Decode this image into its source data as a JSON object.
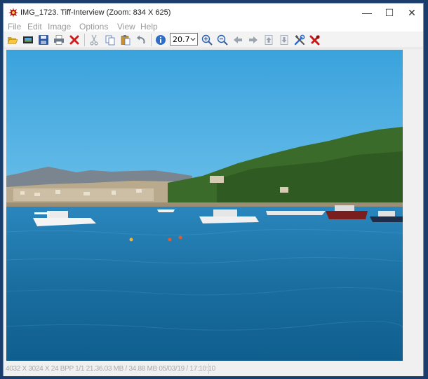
{
  "window": {
    "title": "IMG_1723. Tiff-Interview (Zoom: 834 X 625)",
    "controls": {
      "minimize": "—",
      "maximize": "☐",
      "close": "✕"
    }
  },
  "menu": [
    "File",
    "Edit",
    "Image",
    "Options",
    "View",
    "Help"
  ],
  "toolbar": {
    "zoom_value": "20.7",
    "buttons": [
      {
        "name": "open-button",
        "icon": "folder-open-icon"
      },
      {
        "name": "slideshow-button",
        "icon": "filmstrip-icon"
      },
      {
        "name": "save-button",
        "icon": "floppy-disk-icon"
      },
      {
        "name": "print-button",
        "icon": "printer-icon"
      },
      {
        "name": "delete-button",
        "icon": "red-x-icon"
      },
      {
        "name": "cut-button",
        "icon": "scissors-icon"
      },
      {
        "name": "copy-button",
        "icon": "copy-icon"
      },
      {
        "name": "paste-button",
        "icon": "clipboard-icon"
      },
      {
        "name": "undo-button",
        "icon": "undo-arrow-icon"
      },
      {
        "name": "info-button",
        "icon": "info-icon"
      },
      {
        "name": "zoom-in-button",
        "icon": "zoom-in-icon"
      },
      {
        "name": "zoom-out-button",
        "icon": "zoom-out-icon"
      },
      {
        "name": "previous-button",
        "icon": "arrow-left-icon"
      },
      {
        "name": "next-button",
        "icon": "arrow-right-icon"
      },
      {
        "name": "move-up-button",
        "icon": "page-up-icon"
      },
      {
        "name": "move-down-button",
        "icon": "page-down-icon"
      },
      {
        "name": "settings-button",
        "icon": "tools-icon"
      },
      {
        "name": "exit-button",
        "icon": "exit-icon"
      }
    ]
  },
  "status": {
    "text": "4032 X 3024 X 24 BPP 1/1 21.36.03 MB / 34.88 MB 05/03/19 / 17:10:10"
  },
  "colors": {
    "sky": "#43a6dd",
    "sea": "#1a6fa0",
    "hill": "#3b6b2a",
    "mountain": "#7a8590"
  }
}
